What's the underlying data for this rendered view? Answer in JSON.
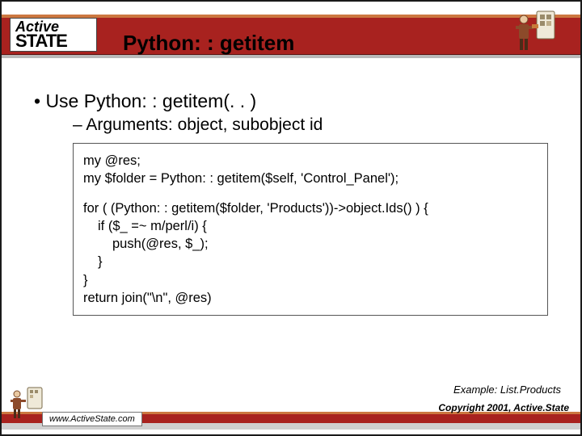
{
  "logo": {
    "top": "Active",
    "bottom": "STATE"
  },
  "slide": {
    "title": "Python: : getitem",
    "bullet": "• Use Python: : getitem(. . )",
    "subbullet": "– Arguments: object, subobject id"
  },
  "code": {
    "l1": "my @res;",
    "l2": "my $folder = Python: : getitem($self, 'Control_Panel');",
    "l3": "for ( (Python: : getitem($folder, 'Products'))->object.Ids() ) {",
    "l4": "if ($_ =~ m/perl/i) {",
    "l5": "push(@res, $_);",
    "l6": "}",
    "l7": "}",
    "l8": "return join(\"\\n\", @res)"
  },
  "example_label": "Example: List.Products",
  "footer": {
    "url": "www.ActiveState.com",
    "copyright": "Copyright 2001, Active.State"
  }
}
